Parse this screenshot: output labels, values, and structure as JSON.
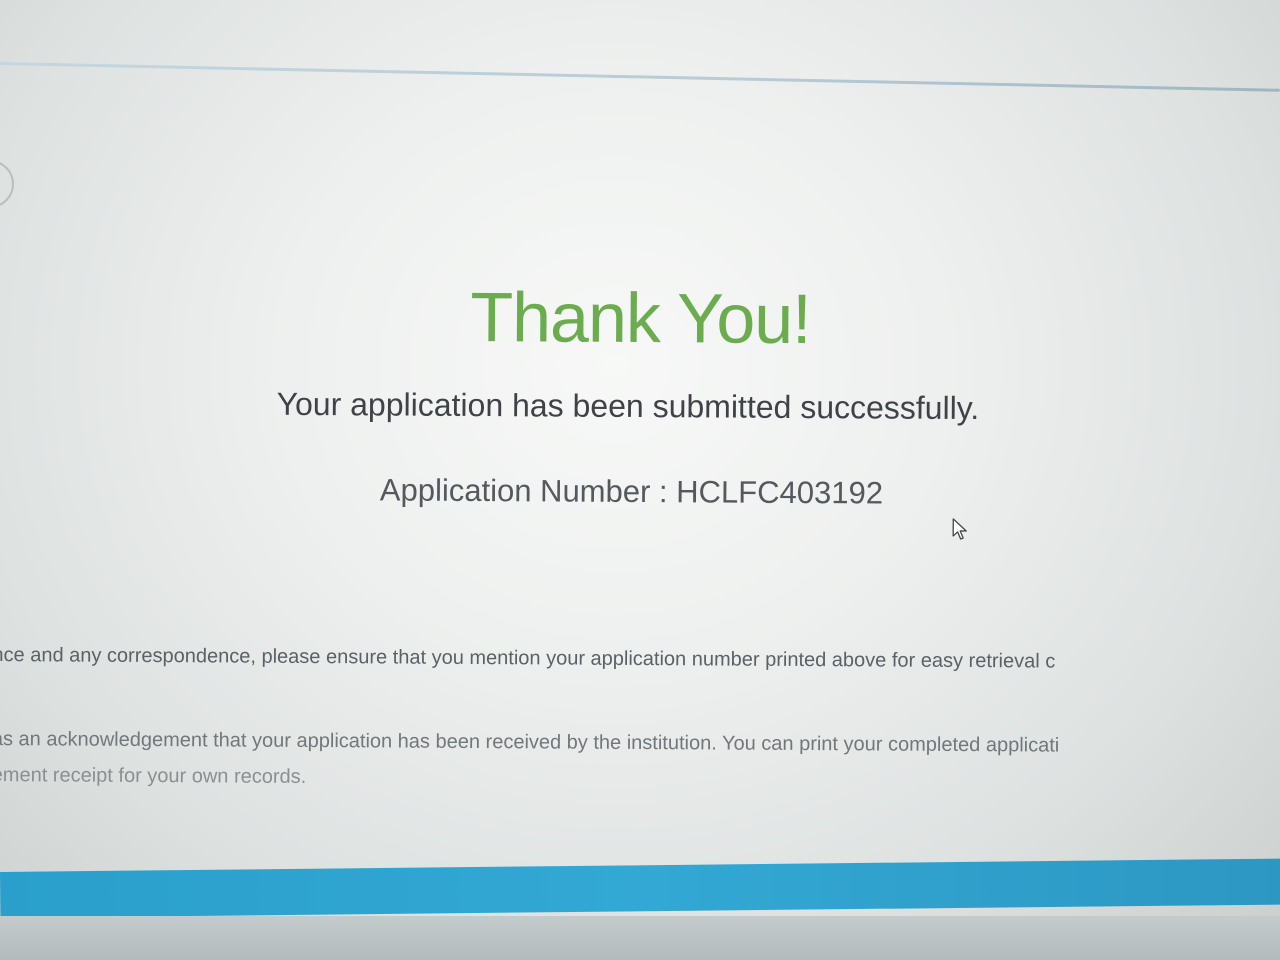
{
  "confirmation": {
    "title": "Thank You!",
    "message": "Your application has been submitted successfully.",
    "application_number_label": "Application Number",
    "application_number_separator": " : ",
    "application_number": "HCLFC403192"
  },
  "info": {
    "line1": "nce and any correspondence, please ensure that you mention your application number printed above for easy retrieval c",
    "line2": "as an acknowledgement that your application has been received by the institution. You can print your completed applicati",
    "line3": "ement receipt for your own records."
  },
  "colors": {
    "title_green": "#6aac4e",
    "accent_blue": "#2ea3cf",
    "text_dark": "#3f4347"
  },
  "icons": {
    "cursor": "mouse-pointer-icon"
  }
}
